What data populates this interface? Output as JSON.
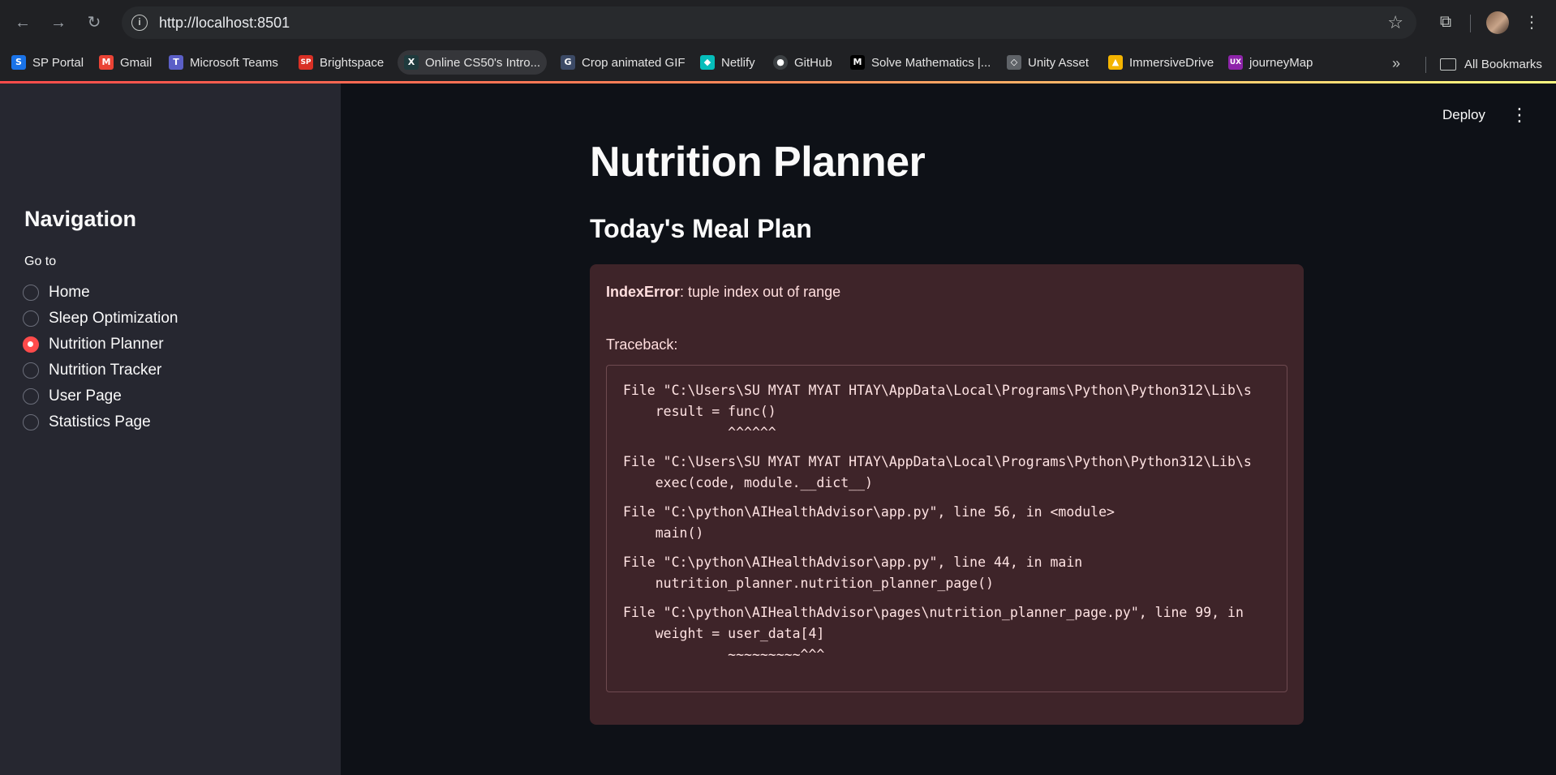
{
  "browser": {
    "url": "http://localhost:8501",
    "bookmarks": [
      {
        "label": "SP Portal",
        "icon": "sp-portal-icon",
        "color": "#1a73e8",
        "glyph": "S"
      },
      {
        "label": "Gmail",
        "icon": "gmail-icon",
        "color": "#ea4335",
        "glyph": "M"
      },
      {
        "label": "Microsoft Teams",
        "icon": "teams-icon",
        "color": "#5b5fc7",
        "glyph": "T"
      },
      {
        "label": "Brightspace",
        "icon": "brightspace-icon",
        "color": "#d93025",
        "glyph": "SP"
      },
      {
        "label": "Online CS50's Intro...",
        "icon": "edx-icon",
        "color": "#1f3a3d",
        "glyph": "X"
      },
      {
        "label": "Crop animated GIF",
        "icon": "ezgif-icon",
        "color": "#3c4a66",
        "glyph": "G"
      },
      {
        "label": "Netlify",
        "icon": "netlify-icon",
        "color": "#05bdba",
        "glyph": "◆"
      },
      {
        "label": "GitHub",
        "icon": "github-icon",
        "color": "#202124",
        "glyph": "●"
      },
      {
        "label": "Solve Mathematics |...",
        "icon": "mathway-icon",
        "color": "#000000",
        "glyph": "M"
      },
      {
        "label": "Unity Asset",
        "icon": "unity-icon",
        "color": "#5f6368",
        "glyph": "◇"
      },
      {
        "label": "ImmersiveDrive",
        "icon": "google-drive-icon",
        "color": "#f4b400",
        "glyph": "▲"
      },
      {
        "label": "journeyMap",
        "icon": "journeymap-icon",
        "color": "#8e24aa",
        "glyph": "UX"
      }
    ],
    "more_label": "»",
    "all_bookmarks_label": "All Bookmarks"
  },
  "app": {
    "deploy_label": "Deploy",
    "sidebar": {
      "title": "Navigation",
      "radio_label": "Go to",
      "options": [
        {
          "label": "Home",
          "selected": false
        },
        {
          "label": "Sleep Optimization",
          "selected": false
        },
        {
          "label": "Nutrition Planner",
          "selected": true
        },
        {
          "label": "Nutrition Tracker",
          "selected": false
        },
        {
          "label": "User Page",
          "selected": false
        },
        {
          "label": "Statistics Page",
          "selected": false
        }
      ]
    },
    "main": {
      "title": "Nutrition Planner",
      "subheader": "Today's Meal Plan",
      "error": {
        "type": "IndexError",
        "message": ": tuple index out of range",
        "traceback_label": "Traceback:",
        "lines": [
          "File \"C:\\Users\\SU MYAT MYAT HTAY\\AppData\\Local\\Programs\\Python\\Python312\\Lib\\s",
          "    result = func()",
          "             ^^^^^^",
          "File \"C:\\Users\\SU MYAT MYAT HTAY\\AppData\\Local\\Programs\\Python\\Python312\\Lib\\s",
          "    exec(code, module.__dict__)",
          "File \"C:\\python\\AIHealthAdvisor\\app.py\", line 56, in <module>",
          "    main()",
          "File \"C:\\python\\AIHealthAdvisor\\app.py\", line 44, in main",
          "    nutrition_planner.nutrition_planner_page()",
          "File \"C:\\python\\AIHealthAdvisor\\pages\\nutrition_planner_page.py\", line 99, in",
          "    weight = user_data[4]",
          "             ~~~~~~~~~^^^"
        ]
      }
    },
    "colors": {
      "accent": "#ff4b4b",
      "sidebar_bg": "#262730",
      "main_bg": "#0e1117",
      "error_bg": "#3e2429"
    }
  }
}
